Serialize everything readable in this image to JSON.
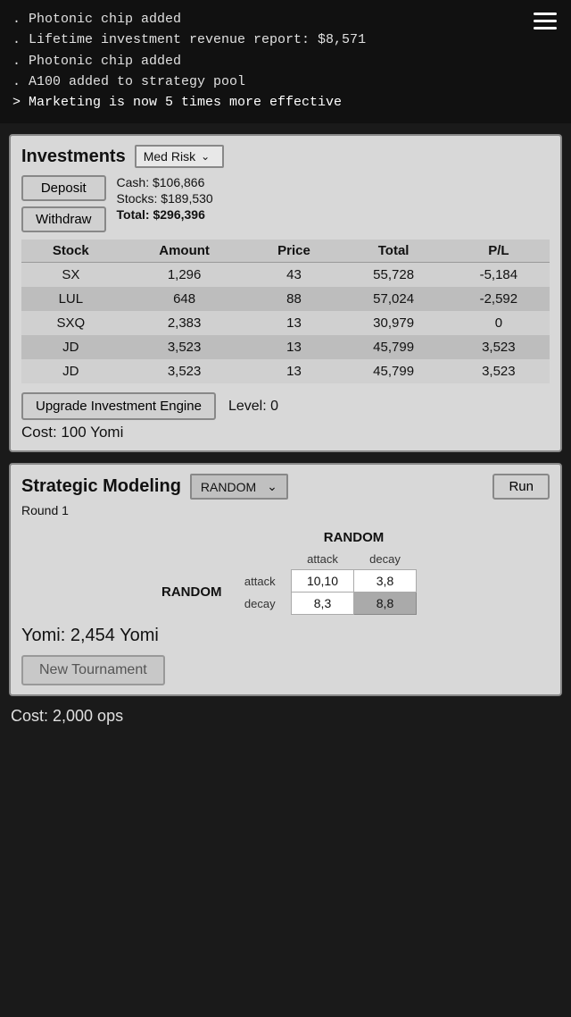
{
  "hamburger": {
    "label": "menu"
  },
  "log": {
    "lines": [
      {
        "text": ". Photonic chip added",
        "type": "normal"
      },
      {
        "text": ". Lifetime investment revenue report: $8,571",
        "type": "normal"
      },
      {
        "text": ". Photonic chip added",
        "type": "normal"
      },
      {
        "text": ". A100 added to strategy pool",
        "type": "normal"
      },
      {
        "text": "> Marketing is now 5 times more effective",
        "type": "command"
      }
    ]
  },
  "investments": {
    "title": "Investments",
    "risk_label": "Med Risk",
    "deposit_label": "Deposit",
    "withdraw_label": "Withdraw",
    "cash_label": "Cash: $106,866",
    "stocks_label": "Stocks: $189,530",
    "total_label": "Total: $296,396",
    "columns": [
      "Stock",
      "Amount",
      "Price",
      "Total",
      "P/L"
    ],
    "rows": [
      {
        "stock": "SX",
        "amount": "1,296",
        "price": "43",
        "total": "55,728",
        "pl": "-5,184"
      },
      {
        "stock": "LUL",
        "amount": "648",
        "price": "88",
        "total": "57,024",
        "pl": "-2,592"
      },
      {
        "stock": "SXQ",
        "amount": "2,383",
        "price": "13",
        "total": "30,979",
        "pl": "0"
      },
      {
        "stock": "JD",
        "amount": "3,523",
        "price": "13",
        "total": "45,799",
        "pl": "3,523"
      },
      {
        "stock": "JD",
        "amount": "3,523",
        "price": "13",
        "total": "45,799",
        "pl": "3,523"
      }
    ],
    "upgrade_btn_label": "Upgrade Investment Engine",
    "level_label": "Level: 0",
    "cost_label": "Cost: 100 Yomi"
  },
  "strategic": {
    "title": "Strategic Modeling",
    "strategy_label": "RANDOM",
    "run_label": "Run",
    "round_label": "Round 1",
    "matrix": {
      "col_header": "RANDOM",
      "row_header": "RANDOM",
      "sub_attack": "attack",
      "sub_decay": "decay",
      "row_attack": "attack",
      "row_decay": "decay",
      "cells": {
        "attack_attack": "10,10",
        "attack_decay": "3,8",
        "decay_attack": "8,3",
        "decay_decay": "8,8"
      }
    },
    "yomi_label": "Yomi: 2,454 Yomi",
    "new_tournament_label": "New Tournament",
    "cost_label": "Cost: 2,000 ops"
  }
}
